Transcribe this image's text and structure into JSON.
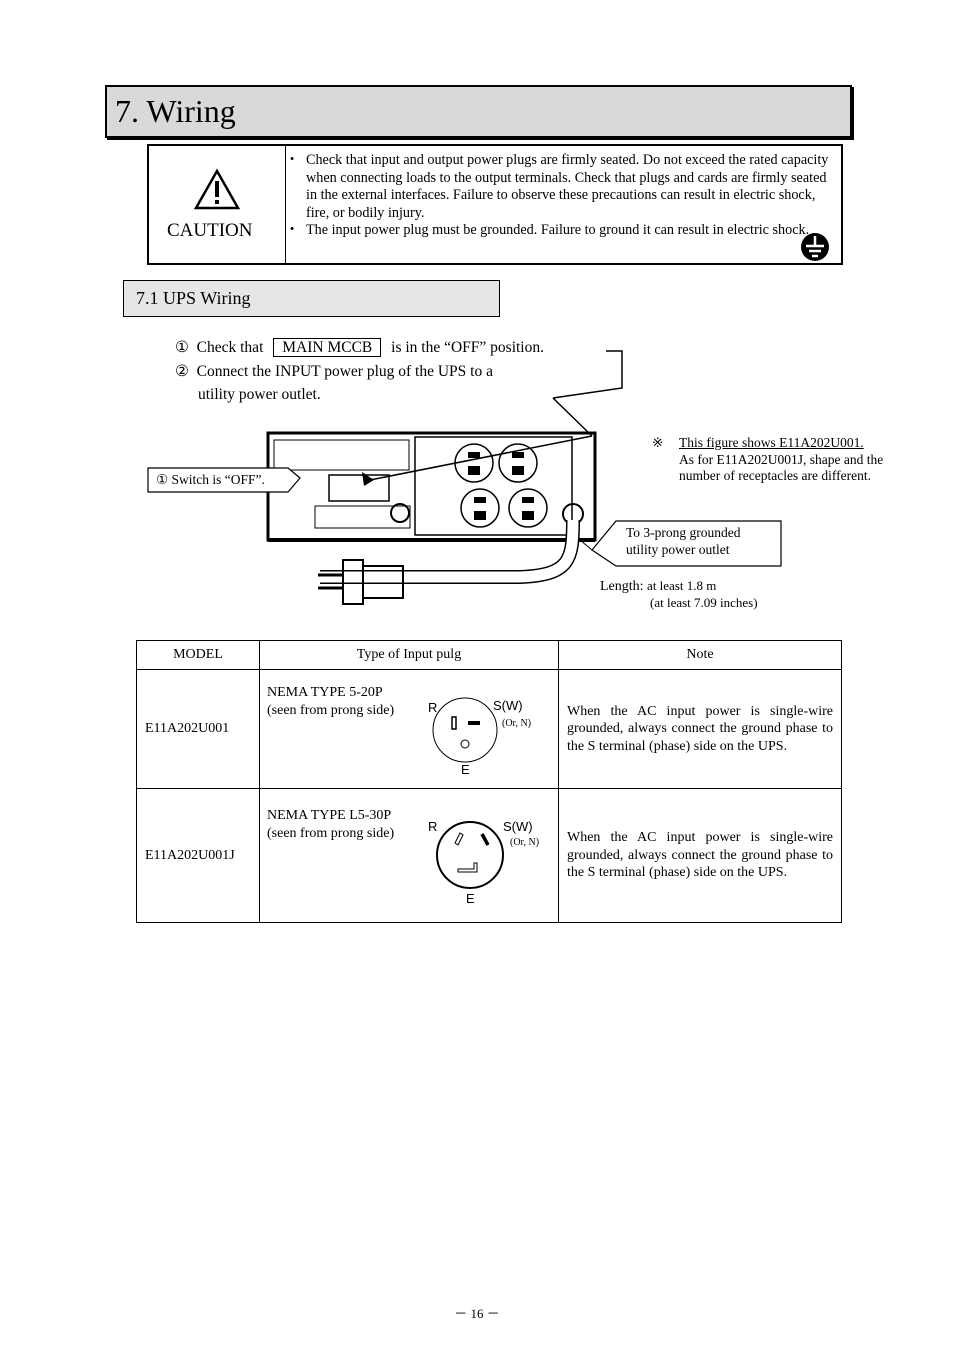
{
  "title": "7. Wiring",
  "caution": {
    "label": "CAUTION",
    "icon": "warning-triangle-icon",
    "ground_icon": "ground-symbol-icon",
    "items": [
      "Check that input and output power plugs are firmly seated. Do not exceed the rated capacity when connecting loads to the output terminals. Check that plugs and cards are firmly seated in the external interfaces. Failure to observe these precautions can result in electric shock, fire, or bodily injury.",
      "The input power plug must be grounded. Failure to ground it can result in electric shock."
    ]
  },
  "section": {
    "title": "7.1 UPS Wiring",
    "step1_num": "①",
    "step1_pre": "Check that",
    "step1_box": "MAIN MCCB",
    "step1_post": "is in the “OFF” position.",
    "step2_num": "②",
    "step2_line1": "Connect the INPUT power plug of the UPS to a",
    "step2_line2": "utility power outlet."
  },
  "figure": {
    "callout_switch": "① Switch is “OFF”.",
    "callout_outlet_1": "To 3-prong grounded",
    "callout_outlet_2": "utility power outlet",
    "length_label": "Length:",
    "length_1": "at least 1.8 m",
    "length_2": "(at least 7.09 inches)",
    "note_mark": "※",
    "note_1": "This figure shows E11A202U001.",
    "note_2": "As for E11A202U001J, shape and the number of receptacles are different."
  },
  "table": {
    "headers": [
      "MODEL",
      "Type of Input pulg",
      "Note"
    ],
    "rows": [
      {
        "model": "E11A202U001",
        "type_1": "NEMA TYPE 5-20P",
        "type_2": "(seen from prong side)",
        "r": "R",
        "s": "S(W)",
        "or": "(Or, N)",
        "e": "E",
        "note": "When the AC input power is single-wire grounded, always connect the ground phase to the S terminal (phase) side on the UPS."
      },
      {
        "model": "E11A202U001J",
        "type_1": "NEMA TYPE L5-30P",
        "type_2": "(seen from prong side)",
        "r": "R",
        "s": "S(W)",
        "or": "(Or, N)",
        "e": "E",
        "note": "When the AC input power is single-wire grounded, always connect the ground phase to the S terminal (phase) side on the UPS."
      }
    ]
  },
  "page_number": "－ 16 －"
}
